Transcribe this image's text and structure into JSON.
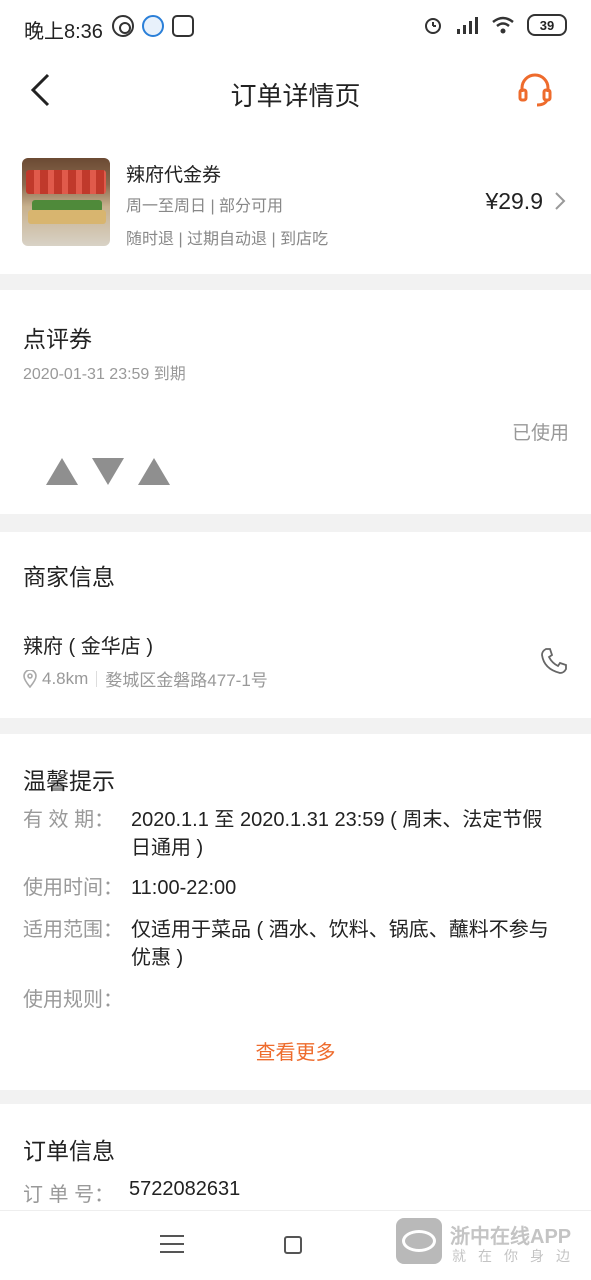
{
  "status_bar": {
    "time": "晚上8:36",
    "battery": "39",
    "icons": [
      "app-icon-1",
      "app-icon-2",
      "app-icon-3",
      "alarm-icon",
      "signal-icon",
      "wifi-icon",
      "battery-icon"
    ]
  },
  "header": {
    "title": "订单详情页"
  },
  "product": {
    "name": "辣府代金券",
    "line1": "周一至周日 | 部分可用",
    "line2": "随时退 | 过期自动退 | 到店吃",
    "price": "¥29.9"
  },
  "coupon": {
    "title": "点评券",
    "expiry": "2020-01-31 23:59 到期",
    "status": "已使用"
  },
  "merchant": {
    "title": "商家信息",
    "name": "辣府 ( 金华店 )",
    "distance": "4.8km",
    "address": "婺城区金磐路477-1号"
  },
  "tips": {
    "title": "温馨提示",
    "rows": [
      {
        "label": "有 效 期：",
        "value": "2020.1.1 至 2020.1.31 23:59 ( 周末、法定节假日通用 )"
      },
      {
        "label": "使用时间：",
        "value": "11:00-22:00"
      },
      {
        "label": "适用范围：",
        "value": "仅适用于菜品 ( 酒水、饮料、锅底、蘸料不参与优惠 )"
      },
      {
        "label": "使用规则：",
        "value": ""
      }
    ],
    "more": "查看更多"
  },
  "order": {
    "title": "订单信息",
    "number_label": "订 单 号：",
    "number": "5722082631"
  },
  "watermark": {
    "text": "浙中在线APP",
    "sub": "就在你身边"
  },
  "colors": {
    "accent": "#ee6b2c",
    "muted": "#999999",
    "divider": "#f2f2f2"
  }
}
